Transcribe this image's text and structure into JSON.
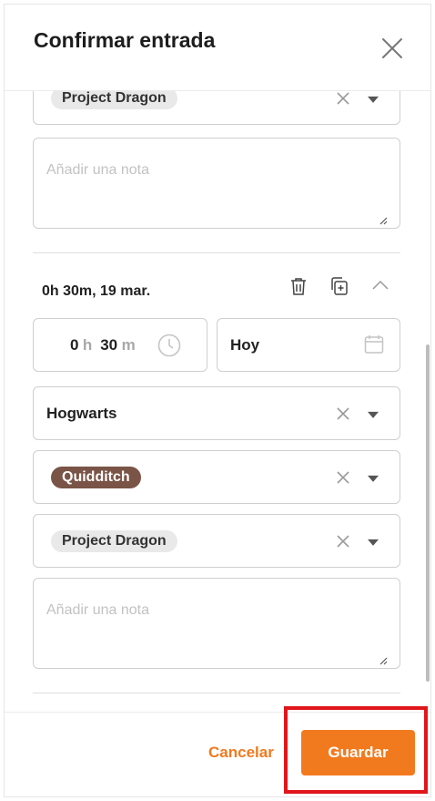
{
  "header": {
    "title": "Confirmar entrada"
  },
  "entry_top": {
    "project_chip": "Project Dragon",
    "note_placeholder": "Añadir una nota"
  },
  "entry_bottom": {
    "summary": "0h 30m, 19 mar.",
    "duration": {
      "hours": "0",
      "hours_unit": "h",
      "minutes": "30",
      "minutes_unit": "m"
    },
    "date": "Hoy",
    "client": "Hogwarts",
    "task_chip": "Quidditch",
    "project_chip": "Project Dragon",
    "note_placeholder": "Añadir una nota"
  },
  "footer": {
    "cancel_label": "Cancelar",
    "save_label": "Guardar"
  },
  "colors": {
    "accent": "#f27a1e",
    "task_chip": "#7a5446",
    "highlight": "#e0161b"
  },
  "icons": [
    "close-icon",
    "clear-icon",
    "chevron-down-icon",
    "trash-icon",
    "duplicate-icon",
    "chevron-up-icon",
    "clock-icon",
    "calendar-icon",
    "resize-grip-icon"
  ]
}
